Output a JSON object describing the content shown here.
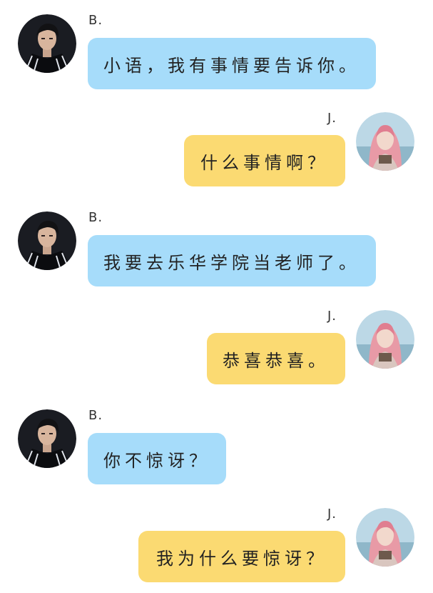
{
  "messages": [
    {
      "sender": "B.",
      "side": "left",
      "text": "小语，我有事情要告诉你。"
    },
    {
      "sender": "J.",
      "side": "right",
      "text": "什么事情啊？"
    },
    {
      "sender": "B.",
      "side": "left",
      "text": "我要去乐华学院当老师了。"
    },
    {
      "sender": "J.",
      "side": "right",
      "text": "恭喜恭喜。"
    },
    {
      "sender": "B.",
      "side": "left",
      "text": "你不惊讶？"
    },
    {
      "sender": "J.",
      "side": "right",
      "text": "我为什么要惊讶？"
    }
  ],
  "colors": {
    "left_bubble": "#a6dcfa",
    "right_bubble": "#fbda72",
    "background": "#ffffff"
  },
  "icons": {
    "b_avatar": "boy-avatar-icon",
    "j_avatar": "girl-avatar-icon"
  }
}
